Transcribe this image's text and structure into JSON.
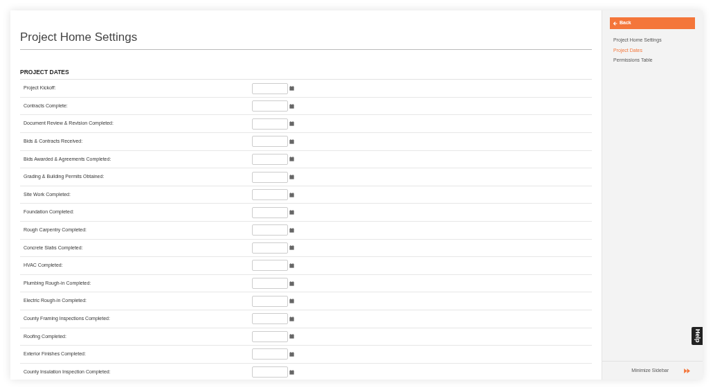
{
  "page": {
    "title": "Project Home Settings",
    "section": "PROJECT DATES"
  },
  "rows": [
    {
      "label": "Project Kickoff:"
    },
    {
      "label": "Contracts Complete:"
    },
    {
      "label": "Document Review & Revision Completed:"
    },
    {
      "label": "Bids & Contracts Received:"
    },
    {
      "label": "Bids Awarded & Agreements Completed:"
    },
    {
      "label": "Grading & Building Permits Obtained:"
    },
    {
      "label": "Site Work Completed:"
    },
    {
      "label": "Foundation Completed:"
    },
    {
      "label": "Rough Carpentry Completed:"
    },
    {
      "label": "Concrete Slabs Completed:"
    },
    {
      "label": "HVAC Completed:"
    },
    {
      "label": "Plumbing Rough-in Completed:"
    },
    {
      "label": "Electric Rough-in Completed:"
    },
    {
      "label": "County Framing Inspections Completed:"
    },
    {
      "label": "Roofing Completed:"
    },
    {
      "label": "Exterior Finishes Completed:"
    },
    {
      "label": "County Insulation Inspection Completed:"
    }
  ],
  "sidebar": {
    "back": "Back",
    "items": [
      {
        "label": "Project Home Settings",
        "selected": false
      },
      {
        "label": "Project Dates",
        "selected": true
      },
      {
        "label": "Permissions Table",
        "selected": false
      }
    ],
    "minimize": "Minimize Sidebar",
    "help": "Help"
  }
}
